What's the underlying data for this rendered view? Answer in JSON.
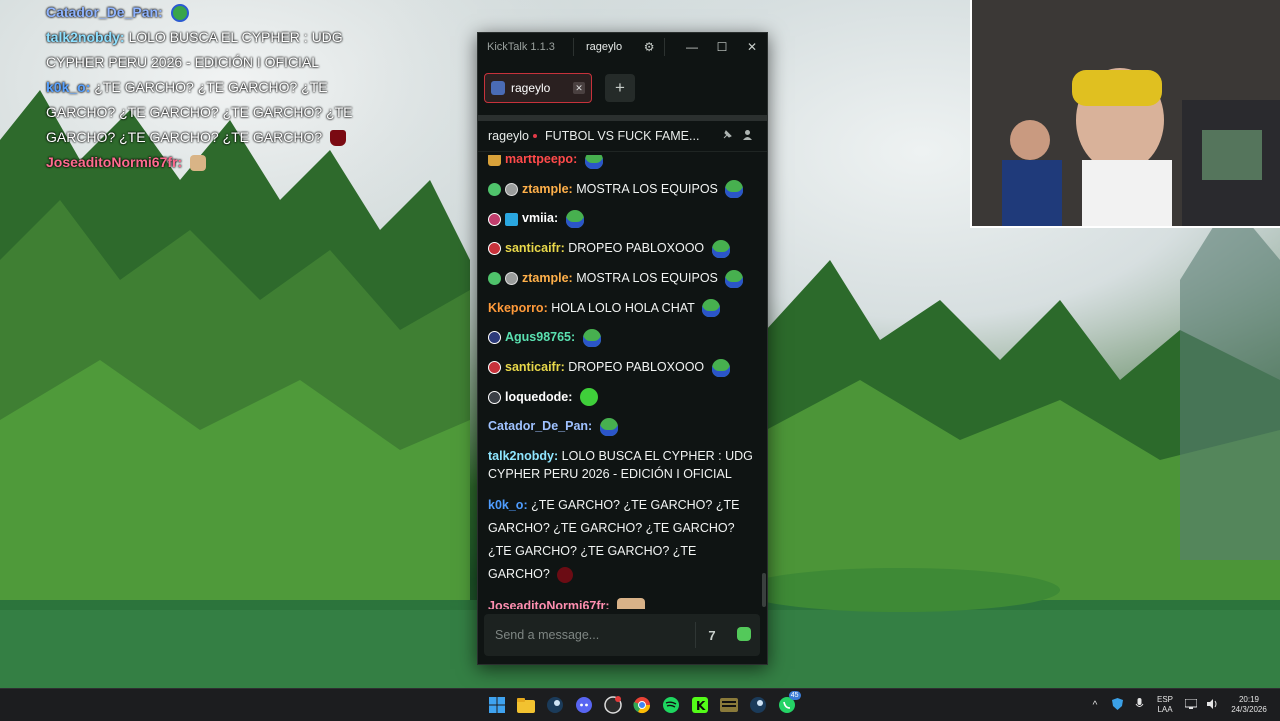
{
  "overlay_chat": [
    {
      "user": "Catador_De_Pan:",
      "color": "#8fb4ff",
      "text": "",
      "emotes": [
        "pepe"
      ]
    },
    {
      "user": "talk2nobdy:",
      "color": "#8fe0ff",
      "text": "LOLO BUSCA EL CYPHER : UDG CYPHER PERU 2026 - EDICIÓN I OFICIAL",
      "emotes": []
    },
    {
      "user": "k0k_o:",
      "color": "#5aa2ff",
      "text": "¿TE GARCHO? ¿TE GARCHO? ¿TE GARCHO? ¿TE GARCHO? ¿TE GARCHO? ¿TE GARCHO? ¿TE GARCHO? ¿TE GARCHO?",
      "emotes": [
        "fez"
      ]
    },
    {
      "user": "JoseaditoNormi67fr:",
      "color": "#ff6b8f",
      "text": "",
      "emotes": [
        "cat"
      ]
    }
  ],
  "window": {
    "app_title": "KickTalk 1.1.3",
    "user": "rageylo",
    "min": "—",
    "max": "☐",
    "close": "✕",
    "settings_icon": "⚙"
  },
  "tabs": [
    {
      "label": "rageylo",
      "close": "✕"
    }
  ],
  "add_tab": "+",
  "channel": {
    "name": "rageylo",
    "title": "FUTBOL VS FUCK FAME...",
    "icons": [
      "pin-icon",
      "user-icon"
    ]
  },
  "messages": [
    {
      "badges": [
        "gold"
      ],
      "user": "marttpeepo:",
      "color": "#ff4a4a",
      "text": "",
      "emotes": [
        "pepe"
      ]
    },
    {
      "badges": [
        "green",
        "grey"
      ],
      "user": "ztample:",
      "color": "#ffb04a",
      "text": "MOSTRA LOS EQUIPOS",
      "emotes": [
        "pepe"
      ]
    },
    {
      "badges": [
        "pink",
        "blue"
      ],
      "user": "vmiia:",
      "color": "#ffffff",
      "text": "",
      "emotes": [
        "pepe"
      ]
    },
    {
      "badges": [
        "red"
      ],
      "user": "santicaifr:",
      "color": "#e8d84a",
      "text": "DROPEO PABLOXOOO",
      "emotes": [
        "pepe"
      ]
    },
    {
      "badges": [
        "green",
        "grey"
      ],
      "user": "ztample:",
      "color": "#ffb04a",
      "text": "MOSTRA LOS EQUIPOS",
      "emotes": [
        "pepe"
      ]
    },
    {
      "badges": [],
      "user": "Kkeporro:",
      "color": "#ff9a3a",
      "text": "HOLA LOLO HOLA CHAT",
      "emotes": [
        "pepe"
      ]
    },
    {
      "badges": [
        "navy"
      ],
      "user": "Agus98765:",
      "color": "#5ae0b0",
      "text": "",
      "emotes": [
        "pepe"
      ]
    },
    {
      "badges": [
        "red"
      ],
      "user": "santicaifr:",
      "color": "#e8d84a",
      "text": "DROPEO PABLOXOOO",
      "emotes": [
        "pepe"
      ]
    },
    {
      "badges": [
        "dark"
      ],
      "user": "loquedode:",
      "color": "#ffffff",
      "text": "",
      "emotes": [
        "frog"
      ]
    },
    {
      "badges": [],
      "user": "Catador_De_Pan:",
      "color": "#9fc2ff",
      "text": "",
      "emotes": [
        "pepe"
      ]
    },
    {
      "badges": [],
      "user": "talk2nobdy:",
      "color": "#8fe6ff",
      "text": "LOLO BUSCA EL CYPHER : UDG CYPHER PERU 2026 - EDICIÓN I OFICIAL",
      "emotes": []
    },
    {
      "badges": [],
      "user": "k0k_o:",
      "color": "#4f9dff",
      "text": "¿TE GARCHO? ¿TE GARCHO? ¿TE GARCHO? ¿TE GARCHO? ¿TE GARCHO? ¿TE GARCHO? ¿TE GARCHO? ¿TE GARCHO?",
      "emotes": [
        "fez"
      ]
    },
    {
      "badges": [],
      "user": "JoseaditoNormi67fr:",
      "color": "#ff8fb0",
      "text": "",
      "emotes": [
        "cat"
      ]
    }
  ],
  "input": {
    "placeholder": "Send a message...",
    "value": "",
    "translate_icon": "7",
    "emote_icon": "emote-icon"
  },
  "taskbar": {
    "icons": [
      "windows-start-icon",
      "file-explorer-icon",
      "steam-icon",
      "discord-icon",
      "obs-icon",
      "chrome-icon",
      "spotify-icon",
      "kick-icon",
      "keyboard-app-icon",
      "steam-icon-2",
      "whatsapp-icon"
    ],
    "whatsapp_badge": "45",
    "tray_caret": "^",
    "lang_top": "ESP",
    "lang_bottom": "LAA",
    "time": "20:19",
    "date": "24/3/2026"
  },
  "colors": {
    "accent_red": "#c7323b",
    "kick_green": "#53c95a",
    "window_bg": "#0f1413"
  }
}
